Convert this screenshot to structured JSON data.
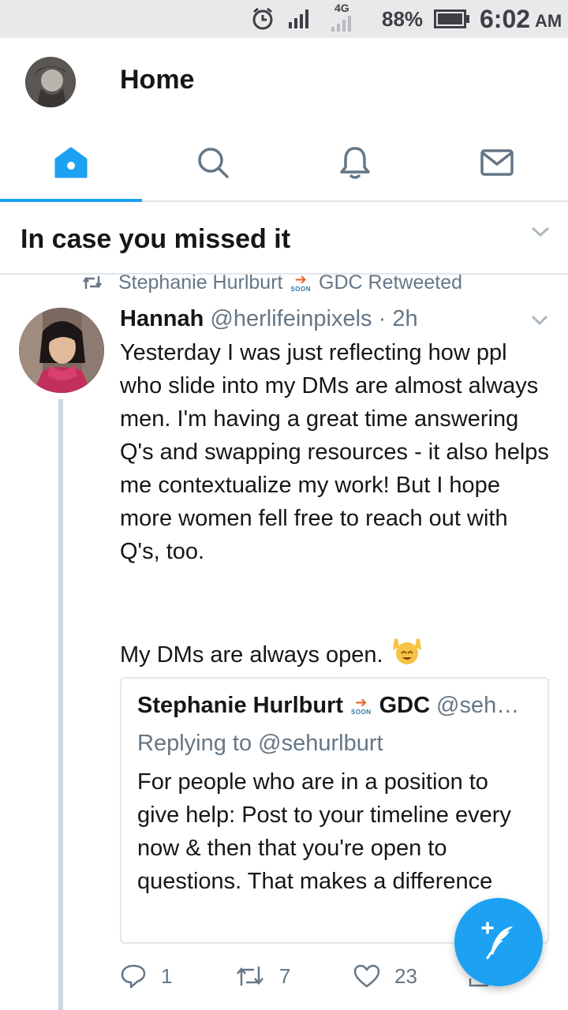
{
  "status_bar": {
    "network": "4G",
    "battery_percent": "88%",
    "time": "6:02",
    "ampm": "AM"
  },
  "header": {
    "title": "Home"
  },
  "tabs": [
    {
      "name": "home",
      "icon": "home-icon",
      "active": true
    },
    {
      "name": "search",
      "icon": "search-icon",
      "active": false
    },
    {
      "name": "notifications",
      "icon": "bell-icon",
      "active": false
    },
    {
      "name": "messages",
      "icon": "mail-icon",
      "active": false
    }
  ],
  "section": {
    "title": "In case you missed it"
  },
  "retweet": {
    "user": "Stephanie Hurlburt",
    "badge_text": "SOON",
    "suffix": "GDC Retweeted"
  },
  "tweet": {
    "name": "Hannah",
    "handle": "@herlifeinpixels",
    "dot": "·",
    "time": "2h",
    "text": "Yesterday I was just reflecting how ppl who slide into my DMs are almost always men. I'm having a great time answering Q's and swapping resources - it also helps me contextualize my work! But I hope more women fell free to reach out with Q's, too.",
    "text2": "My DMs are always open.",
    "emoji": "raising-hands-emoji"
  },
  "quote": {
    "name": "Stephanie Hurlburt",
    "badge_text": "SOON",
    "name_suffix": "GDC",
    "handle": "@seh…",
    "replying": "Replying to @sehurlburt",
    "text": "For people who are in a position to give help: Post to your timeline every now & then that you're open to questions. That makes a difference"
  },
  "actions": {
    "replies": "1",
    "retweets": "7",
    "likes": "23"
  },
  "colors": {
    "accent": "#1da1f2",
    "muted": "#657786",
    "divider": "#e1e8ed",
    "badge_arrow": "#e8632b"
  }
}
